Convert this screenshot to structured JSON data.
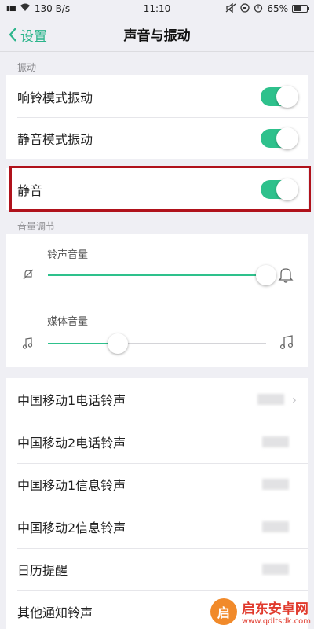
{
  "status_bar": {
    "signal": "▮▮▮",
    "speed": "130 B/s",
    "time": "11:10",
    "battery": "65%",
    "battery_level": 0.65
  },
  "nav": {
    "back_label": "设置",
    "title": "声音与振动"
  },
  "vibration": {
    "section_label": "振动",
    "items": [
      {
        "label": "响铃模式振动",
        "on": true
      },
      {
        "label": "静音模式振动",
        "on": true
      }
    ]
  },
  "mute": {
    "label": "静音",
    "on": true
  },
  "volume": {
    "section_label": "音量调节",
    "ringtone": {
      "label": "铃声音量",
      "level": 1.0
    },
    "media": {
      "label": "媒体音量",
      "level": 0.32
    }
  },
  "ringtones": [
    {
      "label": "中国移动1电话铃声"
    },
    {
      "label": "中国移动2电话铃声"
    },
    {
      "label": "中国移动1信息铃声"
    },
    {
      "label": "中国移动2信息铃声"
    },
    {
      "label": "日历提醒"
    },
    {
      "label": "其他通知铃声"
    }
  ],
  "watermark": {
    "name": "启东安卓网",
    "url": "www.qdltsdk.com",
    "logo_glyph": "启"
  },
  "colors": {
    "accent": "#2ec18c",
    "back": "#2bb58b",
    "highlight": "#b0121b"
  }
}
